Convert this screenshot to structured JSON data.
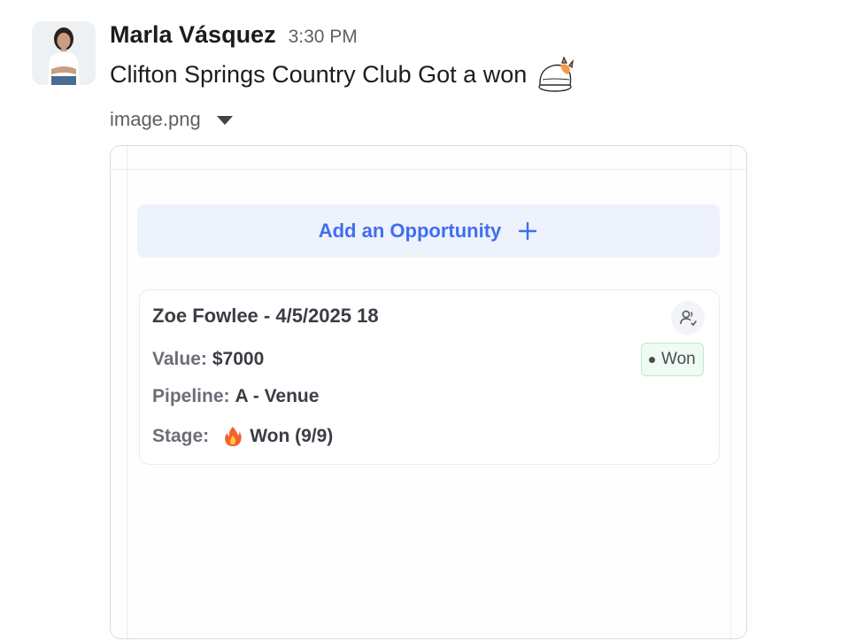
{
  "message": {
    "sender": "Marla Vásquez",
    "timestamp": "3:30 PM",
    "text": "Clifton Springs Country Club Got a won",
    "emoji": "cat-emoji",
    "file_name": "image.png"
  },
  "preview": {
    "add_opportunity_label": "Add an Opportunity",
    "card": {
      "title": "Zoe Fowlee - 4/5/2025 18",
      "value_label": "Value:",
      "value": "$7000",
      "pipeline_label": "Pipeline:",
      "pipeline": "A - Venue",
      "stage_label": "Stage:",
      "stage_icon": "fire-icon",
      "stage": "Won (9/9)",
      "status_badge": "Won"
    }
  },
  "colors": {
    "accent_blue": "#3f6ff0",
    "won_badge_bg": "#eefaf2",
    "won_badge_border": "#bfe8cf",
    "text_primary": "#1d1c1d",
    "text_muted": "#616061"
  }
}
